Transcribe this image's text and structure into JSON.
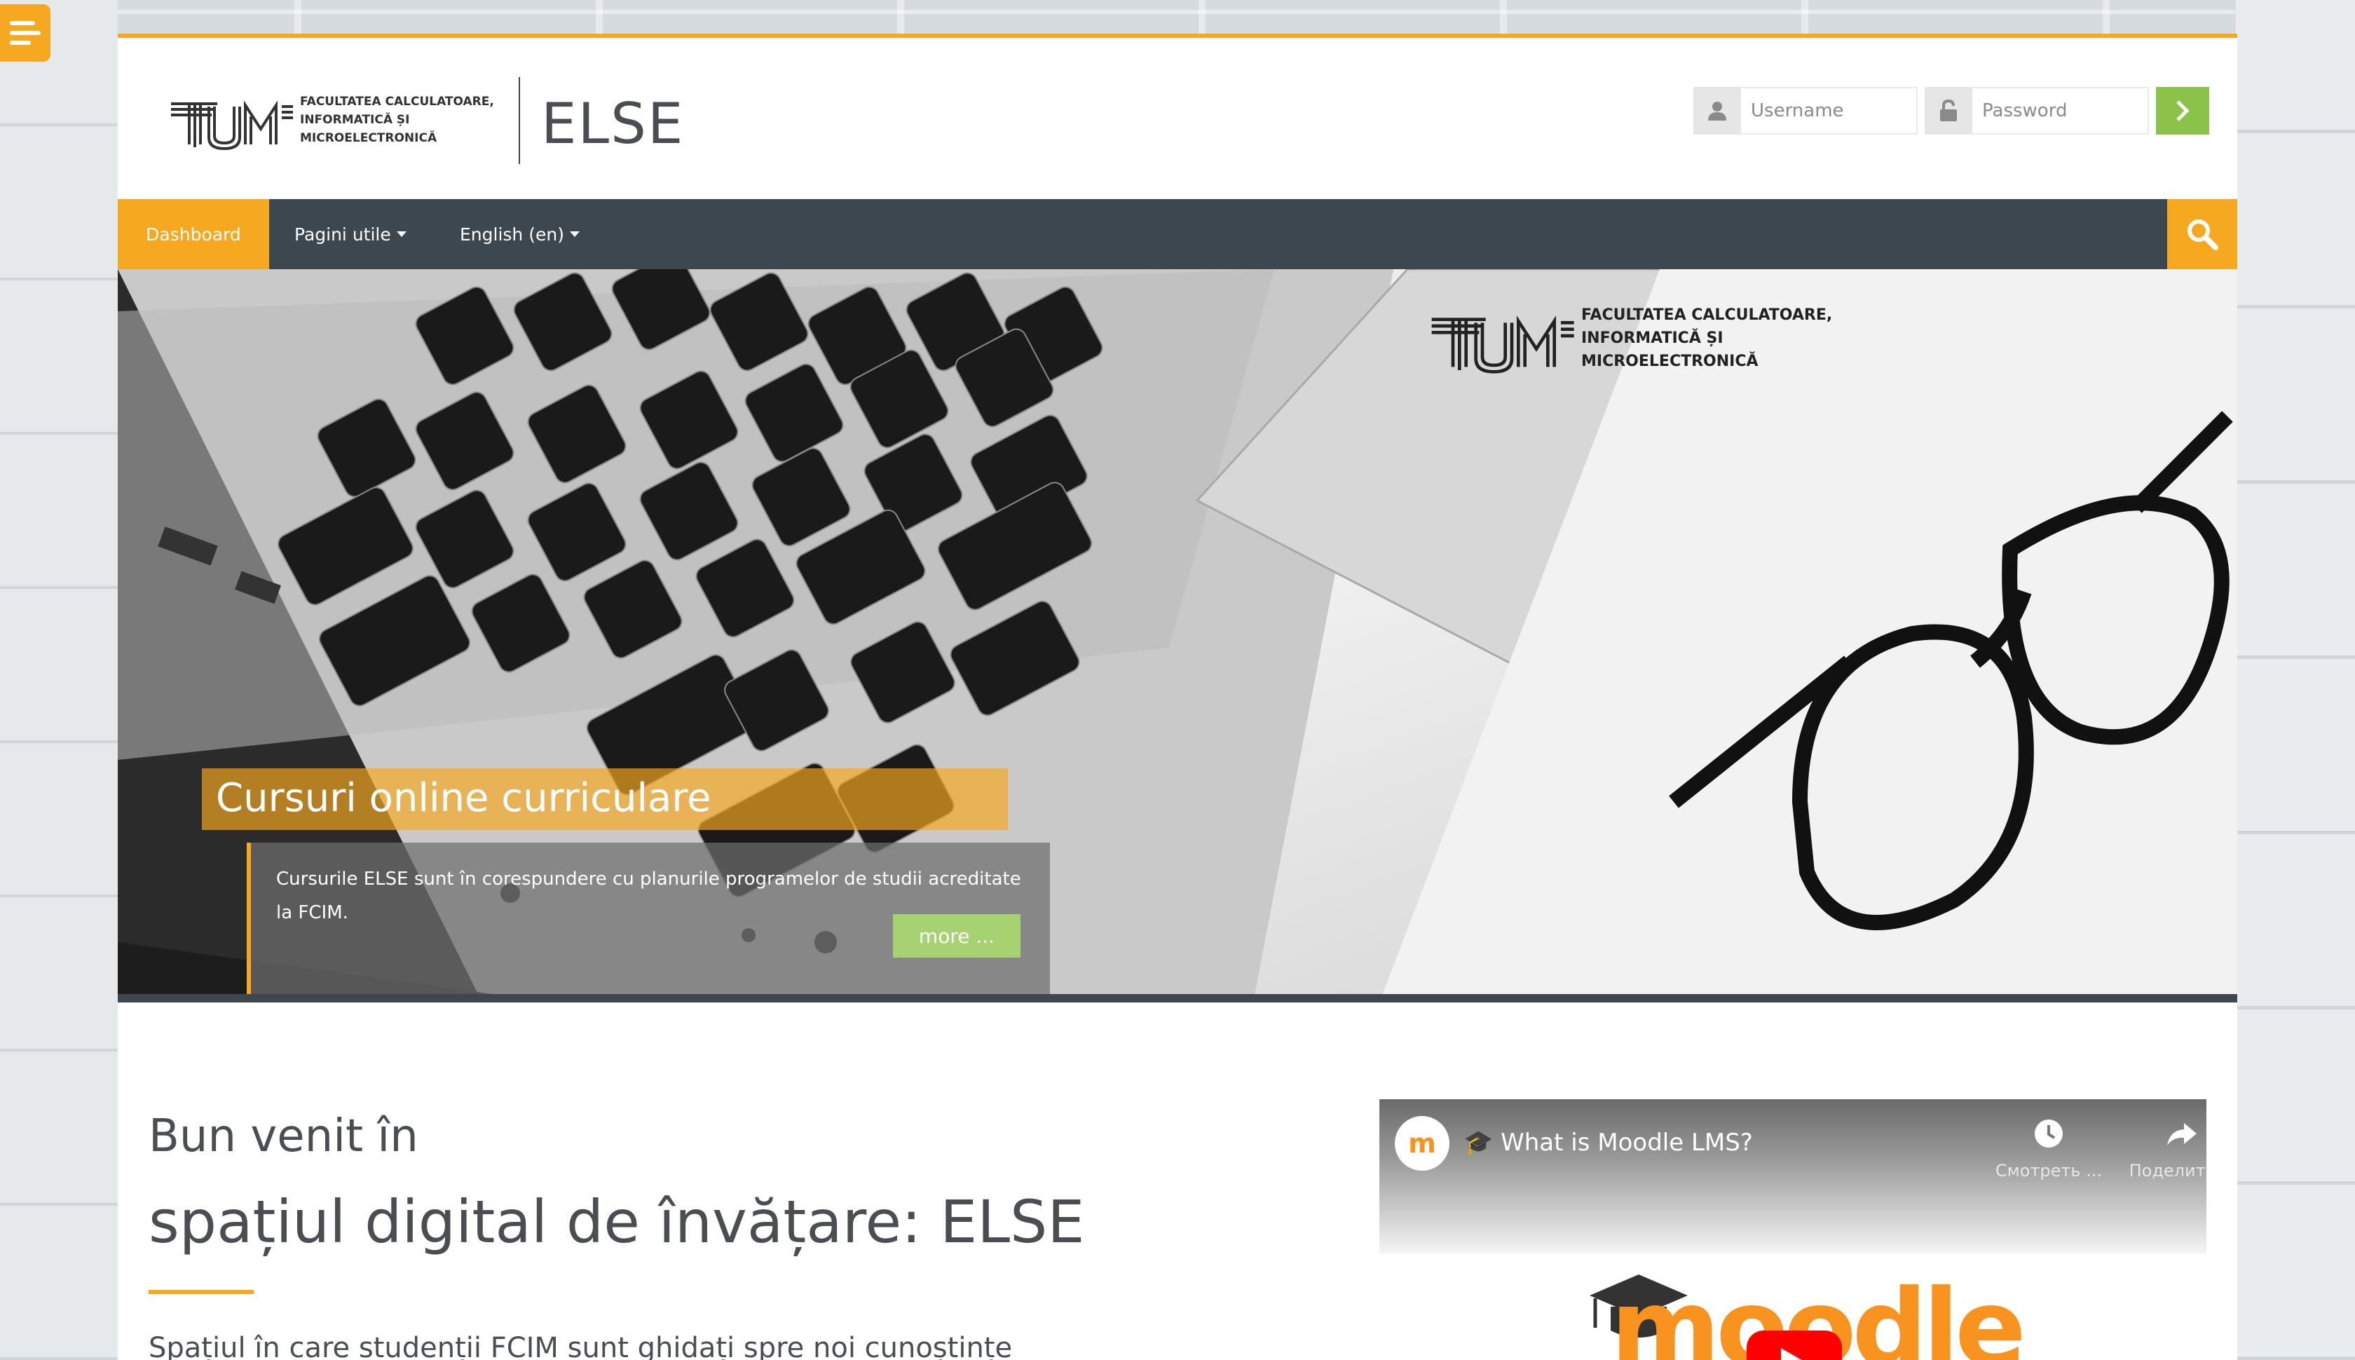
{
  "colors": {
    "accent": "#f6a821",
    "nav_bg": "#3d4750",
    "login_button": "#8bc34a",
    "more_button": "#a6d271",
    "text": "#4a4d52"
  },
  "header": {
    "logo_text": "FACULTATEA CALCULATOARE, INFORMATICĂ ȘI MICROELECTRONICĂ",
    "site_name": "ELSE",
    "login": {
      "username_placeholder": "Username",
      "password_placeholder": "Password",
      "username_icon": "user-icon",
      "password_icon": "lock-icon",
      "submit_icon": "chevron-right-icon"
    }
  },
  "nav": {
    "items": [
      {
        "label": "Dashboard",
        "active": true
      },
      {
        "label": "Pagini utile",
        "dropdown": true
      },
      {
        "label": "English (en)",
        "dropdown": true
      }
    ],
    "search_icon": "search-icon"
  },
  "hero": {
    "logo_text": "FACULTATEA CALCULATOARE, INFORMATICĂ ȘI MICROELECTRONICĂ",
    "title": "Cursuri online curriculare",
    "description": "Cursurile ELSE sunt în corespundere cu planurile programelor de studii acreditate la FCIM.",
    "more_label": "more ..."
  },
  "welcome": {
    "subtitle": "Bun venit în",
    "title": "spațiul digital de învățare: ELSE",
    "description": "Spațiul în care studenții FCIM sunt ghidați spre noi cunoștințe"
  },
  "video": {
    "title": "🎓 What is Moodle LMS?",
    "watch_later": "Смотреть ...",
    "share": "Поделиться",
    "brand_word": "moodle"
  }
}
